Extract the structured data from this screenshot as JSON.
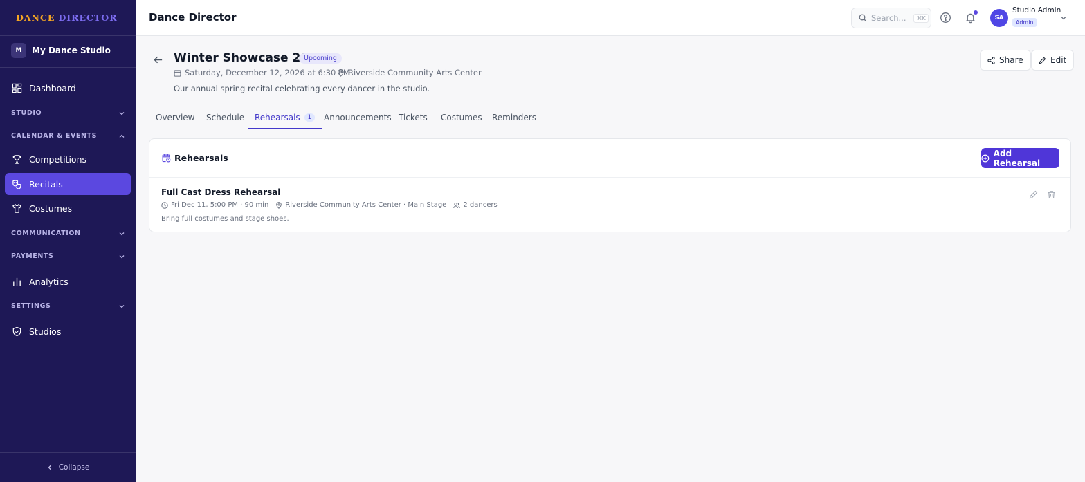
{
  "brand": {
    "part1": "DANCE",
    "part2": "DIRECTOR"
  },
  "studio": {
    "initial": "M",
    "name": "My Dance Studio"
  },
  "sidebar": {
    "items": [
      {
        "label": "Dashboard",
        "icon": "dashboard-icon"
      },
      {
        "label": "Competitions",
        "icon": "trophy-icon"
      },
      {
        "label": "Recitals",
        "icon": "masks-icon",
        "active": true
      },
      {
        "label": "Costumes",
        "icon": "shirt-icon"
      },
      {
        "label": "Analytics",
        "icon": "bar-chart-icon"
      },
      {
        "label": "Studios",
        "icon": "shield-icon"
      }
    ],
    "sections": [
      {
        "label": "STUDIO",
        "expanded": false
      },
      {
        "label": "CALENDAR & EVENTS",
        "expanded": true
      },
      {
        "label": "COMMUNICATION",
        "expanded": false
      },
      {
        "label": "PAYMENTS",
        "expanded": false
      },
      {
        "label": "SETTINGS",
        "expanded": false
      }
    ],
    "collapse_label": "Collapse"
  },
  "header": {
    "title": "Dance Director",
    "search_placeholder": "Search...",
    "search_shortcut": "⌘K",
    "user": {
      "initials": "SA",
      "name": "Studio Admin",
      "role": "Admin"
    }
  },
  "event": {
    "title": "Winter Showcase 2026",
    "status": "Upcoming",
    "date": "Saturday, December 12, 2026 at 6:30 PM",
    "venue": "Riverside Community Arts Center",
    "description": "Our annual spring recital celebrating every dancer in the studio.",
    "share_label": "Share",
    "edit_label": "Edit"
  },
  "tabs": [
    {
      "label": "Overview"
    },
    {
      "label": "Schedule"
    },
    {
      "label": "Rehearsals",
      "count": "1",
      "active": true
    },
    {
      "label": "Announcements"
    },
    {
      "label": "Tickets"
    },
    {
      "label": "Costumes"
    },
    {
      "label": "Reminders"
    }
  ],
  "rehearsals": {
    "section_title": "Rehearsals",
    "add_label": "Add Rehearsal",
    "items": [
      {
        "title": "Full Cast Dress Rehearsal",
        "when": "Fri Dec 11, 5:00 PM · 90 min",
        "where": "Riverside Community Arts Center · Main Stage",
        "dancers": "2 dancers",
        "note": "Bring full costumes and stage shoes."
      }
    ]
  },
  "colors": {
    "sidebar_bg": "#1e1856",
    "accent": "#4f36d8",
    "brand_orange": "#f5a623",
    "brand_purple": "#7c6cf0"
  }
}
